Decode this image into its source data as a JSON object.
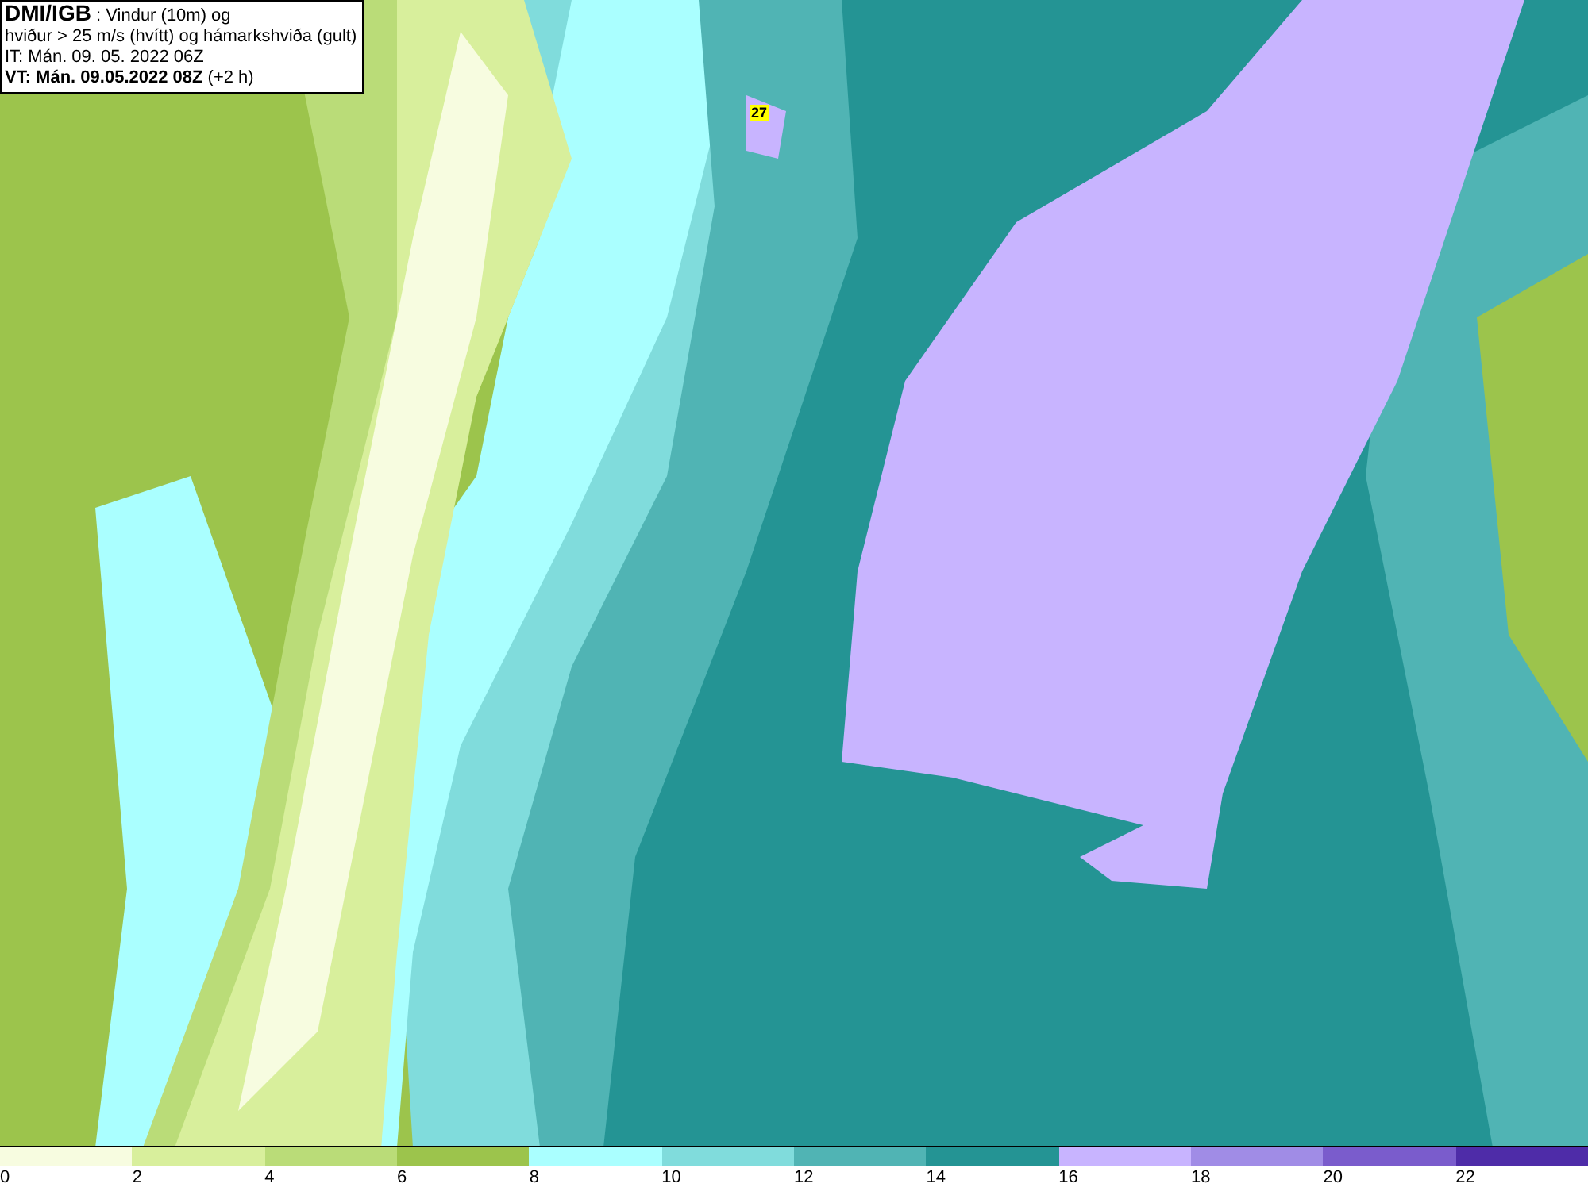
{
  "map": {
    "title_box": {
      "source": "DMI/IGB",
      "title_rest": " : Vindur (10m) og",
      "line_2": "hviður > 25 m/s (hvítt) og hámarkshviða (gult)",
      "issue_time": "IT: Mán. 09. 05. 2022 06Z",
      "valid_time": "VT: Mán. 09.05.2022 08Z",
      "offset": " (+2 h)"
    },
    "max_gust_label": "27"
  },
  "legend": [
    {
      "label": "0",
      "color": "#f7fce0"
    },
    {
      "label": "2",
      "color": "#d8ef9c"
    },
    {
      "label": "4",
      "color": "#badc78"
    },
    {
      "label": "6",
      "color": "#9cc44c"
    },
    {
      "label": "8",
      "color": "#aaffff"
    },
    {
      "label": "10",
      "color": "#80dcdc"
    },
    {
      "label": "12",
      "color": "#50b4b4"
    },
    {
      "label": "14",
      "color": "#249494"
    },
    {
      "label": "16",
      "color": "#c8b4ff"
    },
    {
      "label": "18",
      "color": "#a08ce6"
    },
    {
      "label": "20",
      "color": "#7a5ccc"
    },
    {
      "label": "22",
      "color": "#4e2ca8"
    }
  ]
}
